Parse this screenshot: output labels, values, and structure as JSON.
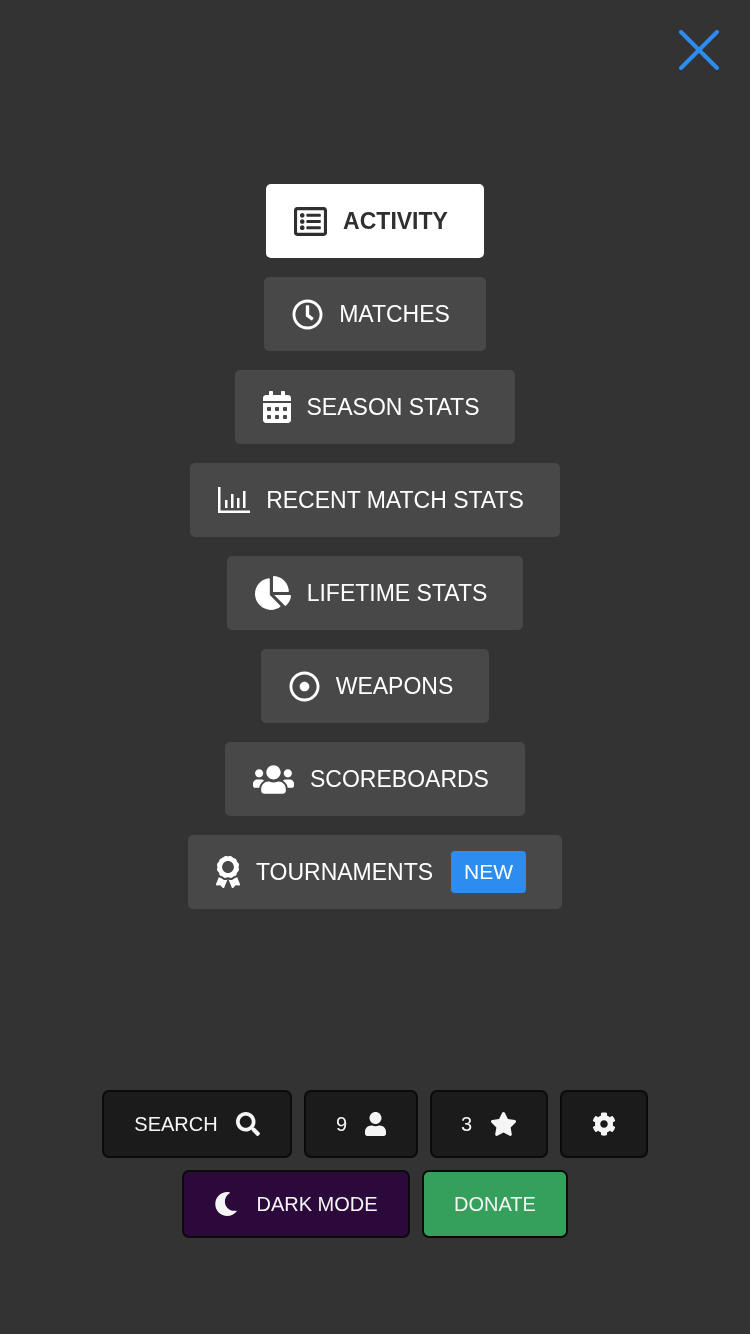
{
  "menu": {
    "items": [
      {
        "label": "ACTIVITY",
        "selected": true
      },
      {
        "label": "MATCHES",
        "selected": false
      },
      {
        "label": "SEASON STATS",
        "selected": false
      },
      {
        "label": "RECENT MATCH STATS",
        "selected": false
      },
      {
        "label": "LIFETIME STATS",
        "selected": false
      },
      {
        "label": "WEAPONS",
        "selected": false
      },
      {
        "label": "SCOREBOARDS",
        "selected": false
      },
      {
        "label": "TOURNAMENTS",
        "selected": false,
        "badge": "NEW"
      }
    ]
  },
  "toolbar": {
    "search_label": "SEARCH",
    "players_count": "9",
    "favorites_count": "3"
  },
  "actions": {
    "dark_mode_label": "DARK MODE",
    "donate_label": "DONATE"
  }
}
